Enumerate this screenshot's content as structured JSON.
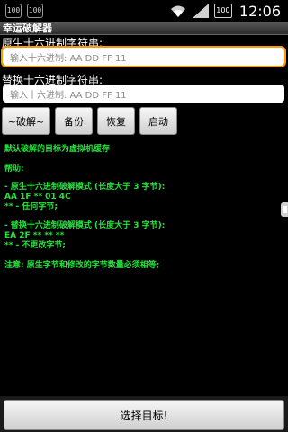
{
  "status_bar": {
    "left_icons": [
      {
        "name": "battery-100-icon",
        "text": "100"
      },
      {
        "name": "sd-card-icon",
        "text": "100"
      }
    ],
    "battery_level": "100",
    "time": "12:06"
  },
  "app": {
    "title": "幸运破解器"
  },
  "fields": {
    "original_label": "原生十六进制字符串:",
    "original_placeholder": "输入十六进制: AA DD FF 11",
    "replace_label": "替换十六进制字符串:",
    "replace_placeholder": "输入十六进制: AA DD FF 11"
  },
  "buttons": {
    "crack": "~破解~",
    "backup": "备份",
    "restore": "恢复",
    "start": "启动"
  },
  "info": {
    "default_target": "默认破解的目标为虚拟机缓存",
    "help_heading": "帮助:",
    "original_mode": "- 原生十六进制破解模式 (长度大于 3 字节):",
    "original_example": "AA 1F ** 01 4C",
    "original_note": "** - 任何字节;",
    "replace_mode": "- 替换十六进制破解模式 (长度大于 3 字节):",
    "replace_example": "EA 2F ** ** **",
    "replace_note": "** - 不更改字节;",
    "notice": "注意: 原生字节和修改的字节数量必须相等;"
  },
  "footer": {
    "select_target": "选择目标!"
  }
}
